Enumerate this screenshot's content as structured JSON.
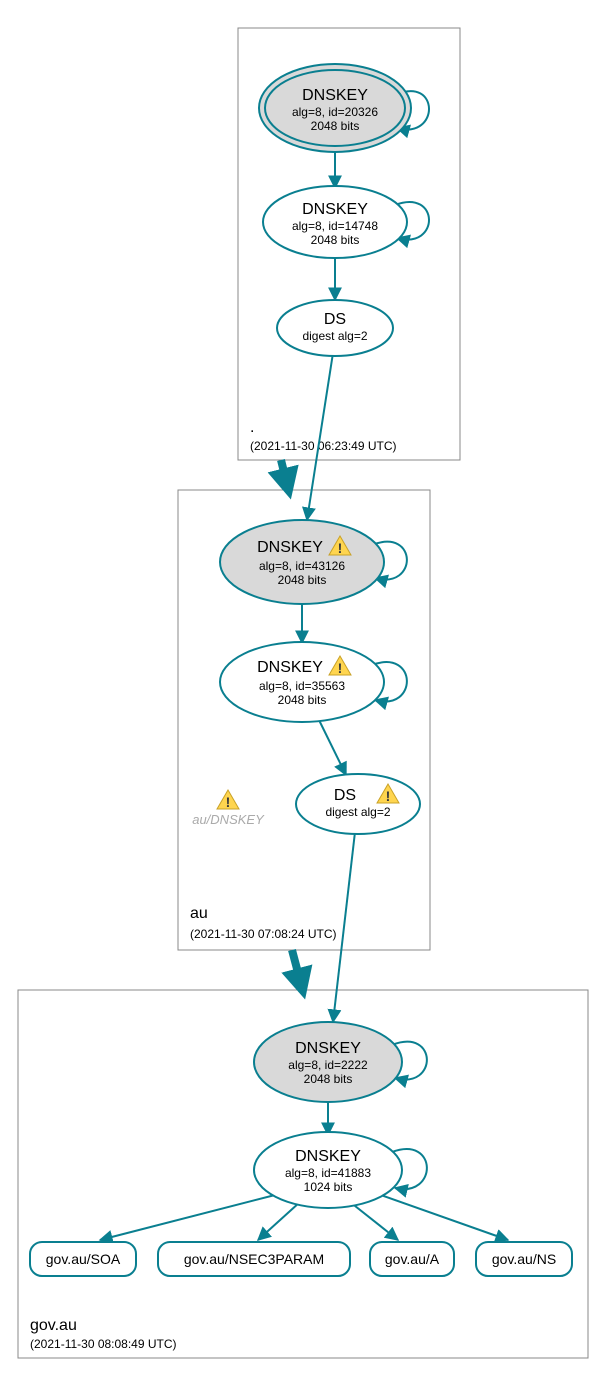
{
  "zones": {
    "root": {
      "name": ".",
      "timestamp": "(2021-11-30 06:23:49 UTC)"
    },
    "au": {
      "name": "au",
      "timestamp": "(2021-11-30 07:08:24 UTC)"
    },
    "govau": {
      "name": "gov.au",
      "timestamp": "(2021-11-30 08:08:49 UTC)"
    }
  },
  "nodes": {
    "root_ksk": {
      "title": "DNSKEY",
      "line2": "alg=8, id=20326",
      "line3": "2048 bits"
    },
    "root_zsk": {
      "title": "DNSKEY",
      "line2": "alg=8, id=14748",
      "line3": "2048 bits"
    },
    "root_ds": {
      "title": "DS",
      "line2": "digest alg=2"
    },
    "au_ksk": {
      "title": "DNSKEY",
      "line2": "alg=8, id=43126",
      "line3": "2048 bits"
    },
    "au_zsk": {
      "title": "DNSKEY",
      "line2": "alg=8, id=35563",
      "line3": "2048 bits"
    },
    "au_ds": {
      "title": "DS",
      "line2": "digest alg=2"
    },
    "au_ghost": {
      "label": "au/DNSKEY"
    },
    "govau_ksk": {
      "title": "DNSKEY",
      "line2": "alg=8, id=2222",
      "line3": "2048 bits"
    },
    "govau_zsk": {
      "title": "DNSKEY",
      "line2": "alg=8, id=41883",
      "line3": "1024 bits"
    },
    "rr_soa": {
      "label": "gov.au/SOA"
    },
    "rr_nsec3": {
      "label": "gov.au/NSEC3PARAM"
    },
    "rr_a": {
      "label": "gov.au/A"
    },
    "rr_ns": {
      "label": "gov.au/NS"
    }
  }
}
